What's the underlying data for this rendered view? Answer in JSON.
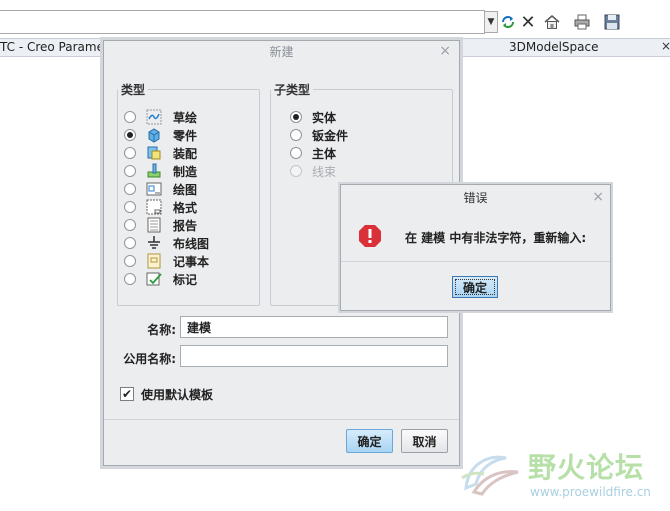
{
  "browser": {
    "tab1": "TC - Creo Parametr",
    "tab2": "3DModelSpace",
    "tab_close": "×",
    "toolbar_icons": [
      "chevron-down-icon",
      "refresh-icon",
      "stop-icon",
      "home-icon",
      "print-icon",
      "save-icon"
    ]
  },
  "new_dialog": {
    "title": "新建",
    "close": "×",
    "type_legend": "类型",
    "subtype_legend": "子类型",
    "types": [
      {
        "label": "草绘",
        "icon": "sketch-icon",
        "selected": false
      },
      {
        "label": "零件",
        "icon": "part-icon",
        "selected": true
      },
      {
        "label": "装配",
        "icon": "assembly-icon",
        "selected": false
      },
      {
        "label": "制造",
        "icon": "manufacturing-icon",
        "selected": false
      },
      {
        "label": "绘图",
        "icon": "drawing-icon",
        "selected": false
      },
      {
        "label": "格式",
        "icon": "format-icon",
        "selected": false
      },
      {
        "label": "报告",
        "icon": "report-icon",
        "selected": false
      },
      {
        "label": "布线图",
        "icon": "diagram-icon",
        "selected": false
      },
      {
        "label": "记事本",
        "icon": "notebook-icon",
        "selected": false
      },
      {
        "label": "标记",
        "icon": "markup-icon",
        "selected": false
      }
    ],
    "subtypes": [
      {
        "label": "实体",
        "selected": true,
        "disabled": false
      },
      {
        "label": "钣金件",
        "selected": false,
        "disabled": false
      },
      {
        "label": "主体",
        "selected": false,
        "disabled": false
      },
      {
        "label": "线束",
        "selected": false,
        "disabled": true
      }
    ],
    "name_label": "名称:",
    "name_value": "建模",
    "common_name_label": "公用名称:",
    "common_name_value": "",
    "use_default_template_label": "使用默认模板",
    "use_default_template_checked": true,
    "ok_label": "确定",
    "cancel_label": "取消"
  },
  "error_dialog": {
    "title": "错误",
    "close": "×",
    "message": "在 建模 中有非法字符，重新输入:",
    "ok_label": "确定"
  },
  "watermark": {
    "title": "野火论坛",
    "url": "www.proewildfire.cn"
  }
}
